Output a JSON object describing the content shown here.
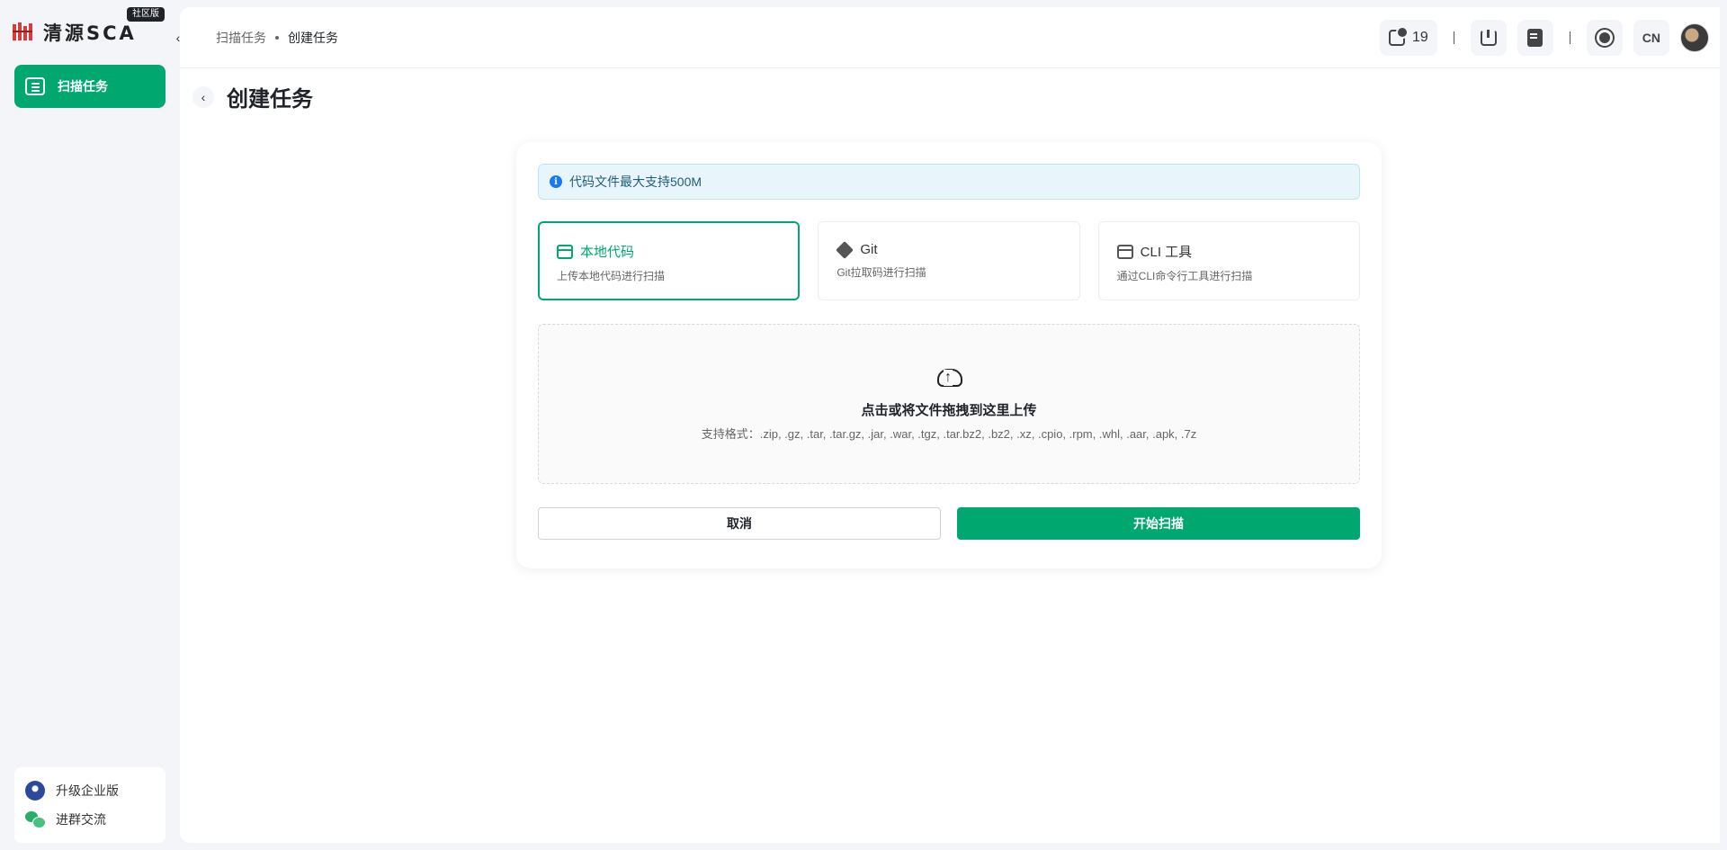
{
  "brand": {
    "logo_text": "清源SCA",
    "edition_badge": "社区版",
    "brand_color": "#00a870"
  },
  "sidebar": {
    "items": [
      {
        "label": "扫描任务",
        "icon": "scan-task-icon",
        "active": true
      }
    ],
    "bottom": [
      {
        "label": "升级企业版",
        "icon": "rocket-icon"
      },
      {
        "label": "进群交流",
        "icon": "wechat-icon"
      }
    ]
  },
  "header": {
    "breadcrumb": [
      "扫描任务",
      "创建任务"
    ],
    "task_count": "19",
    "language": "CN",
    "icons": [
      "task-queue-icon",
      "download-icon",
      "report-icon",
      "theme-sun-icon",
      "avatar"
    ]
  },
  "page": {
    "title": "创建任务"
  },
  "form": {
    "alert": "代码文件最大支持500M",
    "options": [
      {
        "title": "本地代码",
        "desc": "上传本地代码进行扫描",
        "icon": "local-code-icon",
        "selected": true
      },
      {
        "title": "Git",
        "desc": "Git拉取码进行扫描",
        "icon": "git-icon",
        "selected": false
      },
      {
        "title": "CLI 工具",
        "desc": "通过CLI命令行工具进行扫描",
        "icon": "cli-icon",
        "selected": false
      }
    ],
    "upload": {
      "title": "点击或将文件拖拽到这里上传",
      "formats": "支持格式：.zip, .gz, .tar, .tar.gz, .jar, .war, .tgz, .tar.bz2, .bz2, .xz, .cpio, .rpm, .whl, .aar, .apk, .7z"
    },
    "cancel_label": "取消",
    "start_label": "开始扫描"
  }
}
